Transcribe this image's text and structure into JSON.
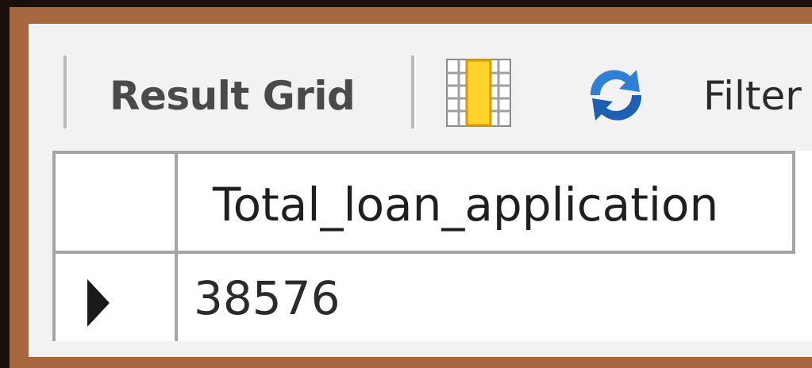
{
  "toolbar": {
    "result_grid_label": "Result Grid",
    "filter_label": "Filter",
    "grid_icon": "column-grid-icon",
    "refresh_icon": "refresh-icon"
  },
  "result_grid": {
    "columns": [
      "Total_loan_application"
    ],
    "rows": [
      [
        "38576"
      ]
    ]
  },
  "colors": {
    "frame": "#a8683f",
    "background": "#f2f2f2",
    "grid_border": "#a5a5a5"
  }
}
